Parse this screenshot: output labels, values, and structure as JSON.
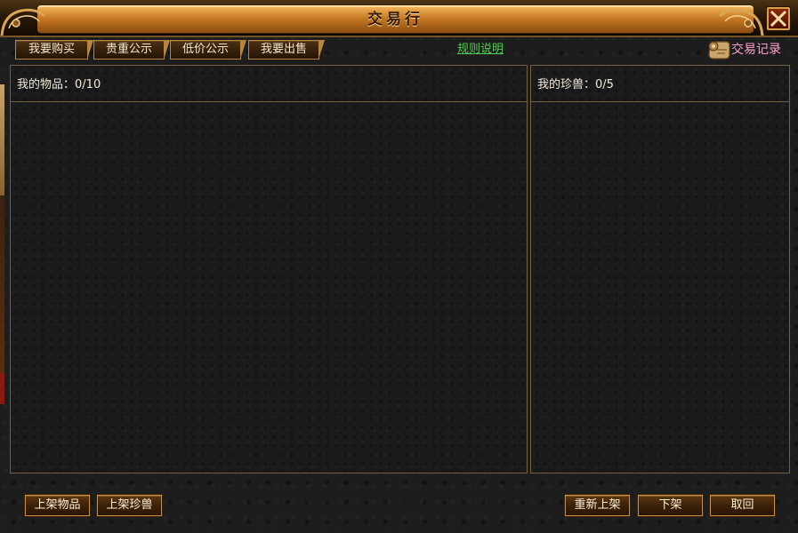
{
  "window": {
    "title": "交易行",
    "close_icon": "close-icon"
  },
  "tabs": [
    {
      "label": "我要购买"
    },
    {
      "label": "贵重公示"
    },
    {
      "label": "低价公示"
    },
    {
      "label": "我要出售"
    }
  ],
  "header_links": {
    "rules": "规则说明",
    "trade_record": "交易记录",
    "trade_record_icon": "scroll-icon"
  },
  "panels": {
    "items": {
      "label": "我的物品：",
      "count": "0/10"
    },
    "pets": {
      "label": "我的珍兽：",
      "count": "0/5"
    }
  },
  "buttons": {
    "list_item": "上架物品",
    "list_pet": "上架珍兽",
    "relist": "重新上架",
    "delist": "下架",
    "back": "取回"
  },
  "colors": {
    "accent_gold": "#c98f3e",
    "rules_link": "#4fce4f",
    "trade_record": "#ff9fce",
    "title_banner": "#c77a24"
  }
}
